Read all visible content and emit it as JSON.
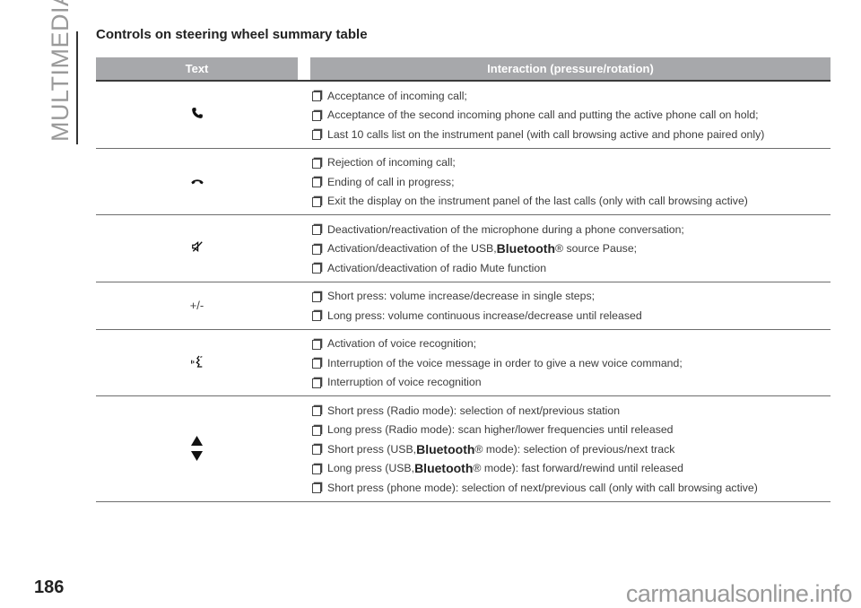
{
  "section_label": "MULTIMEDIA",
  "title": "Controls on steering wheel summary table",
  "table": {
    "headers": [
      "Text",
      "Interaction (pressure/rotation)"
    ],
    "rows": [
      {
        "control_icon": "phone-answer-icon",
        "control_text": "",
        "items": [
          {
            "pre": "Acceptance of incoming call;",
            "bold": "",
            "post": ""
          },
          {
            "pre": "Acceptance of the second incoming phone call and putting the active phone call on hold;",
            "bold": "",
            "post": ""
          },
          {
            "pre": "Last 10 calls list on the instrument panel (with call browsing active and phone paired only)",
            "bold": "",
            "post": ""
          }
        ]
      },
      {
        "control_icon": "phone-hangup-icon",
        "control_text": "",
        "items": [
          {
            "pre": "Rejection of incoming call;",
            "bold": "",
            "post": ""
          },
          {
            "pre": "Ending of call in progress;",
            "bold": "",
            "post": ""
          },
          {
            "pre": "Exit the display on the instrument panel of the last calls (only with call browsing active)",
            "bold": "",
            "post": ""
          }
        ]
      },
      {
        "control_icon": "mute-icon",
        "control_text": "",
        "items": [
          {
            "pre": "Deactivation/reactivation of the microphone during a phone conversation;",
            "bold": "",
            "post": ""
          },
          {
            "pre": "Activation/deactivation of the USB, ",
            "bold": "Bluetooth",
            "post": "® source Pause;"
          },
          {
            "pre": "Activation/deactivation of radio Mute function",
            "bold": "",
            "post": ""
          }
        ]
      },
      {
        "control_icon": "",
        "control_text": "+/-",
        "items": [
          {
            "pre": "Short press: volume increase/decrease in single steps;",
            "bold": "",
            "post": ""
          },
          {
            "pre": "Long press: volume continuous increase/decrease until released",
            "bold": "",
            "post": ""
          }
        ]
      },
      {
        "control_icon": "voice-recognition-icon",
        "control_text": "",
        "items": [
          {
            "pre": "Activation of voice recognition;",
            "bold": "",
            "post": ""
          },
          {
            "pre": "Interruption of the voice message in order to give a new voice command;",
            "bold": "",
            "post": ""
          },
          {
            "pre": "Interruption of voice recognition",
            "bold": "",
            "post": ""
          }
        ]
      },
      {
        "control_icon": "up-down-arrows-icon",
        "control_text": "",
        "items": [
          {
            "pre": "Short press (Radio mode): selection of next/previous station",
            "bold": "",
            "post": ""
          },
          {
            "pre": "Long press (Radio mode): scan higher/lower frequencies until released",
            "bold": "",
            "post": ""
          },
          {
            "pre": "Short press (USB, ",
            "bold": "Bluetooth",
            "post": "® mode): selection of previous/next track"
          },
          {
            "pre": "Long press (USB, ",
            "bold": "Bluetooth",
            "post": "® mode): fast forward/rewind until released"
          },
          {
            "pre": "Short press (phone mode): selection of next/previous call (only with call browsing active)",
            "bold": "",
            "post": ""
          }
        ]
      }
    ]
  },
  "page_number": "186",
  "watermark": "carmanualsonline.info"
}
